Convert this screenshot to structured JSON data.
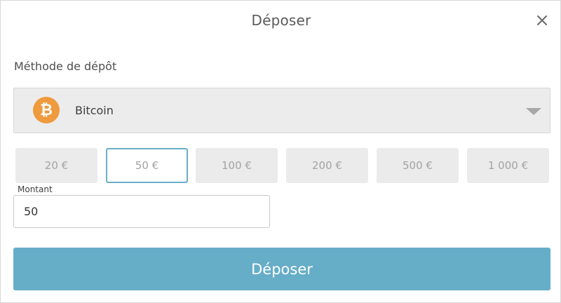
{
  "modal": {
    "title": "Déposer",
    "close_icon": "close-icon"
  },
  "method": {
    "label": "Méthode de dépôt",
    "selected": "Bitcoin",
    "icon": "bitcoin-icon",
    "icon_color": "#ee9a3d",
    "icon_glyph": "₿"
  },
  "presets": [
    {
      "label": "20 €",
      "active": false
    },
    {
      "label": "50 €",
      "active": true
    },
    {
      "label": "100 €",
      "active": false
    },
    {
      "label": "200 €",
      "active": false
    },
    {
      "label": "500 €",
      "active": false
    },
    {
      "label": "1 000 €",
      "active": false
    }
  ],
  "amount": {
    "label": "Montant",
    "value": "50"
  },
  "submit": {
    "label": "Déposer",
    "color": "#66adc8"
  }
}
